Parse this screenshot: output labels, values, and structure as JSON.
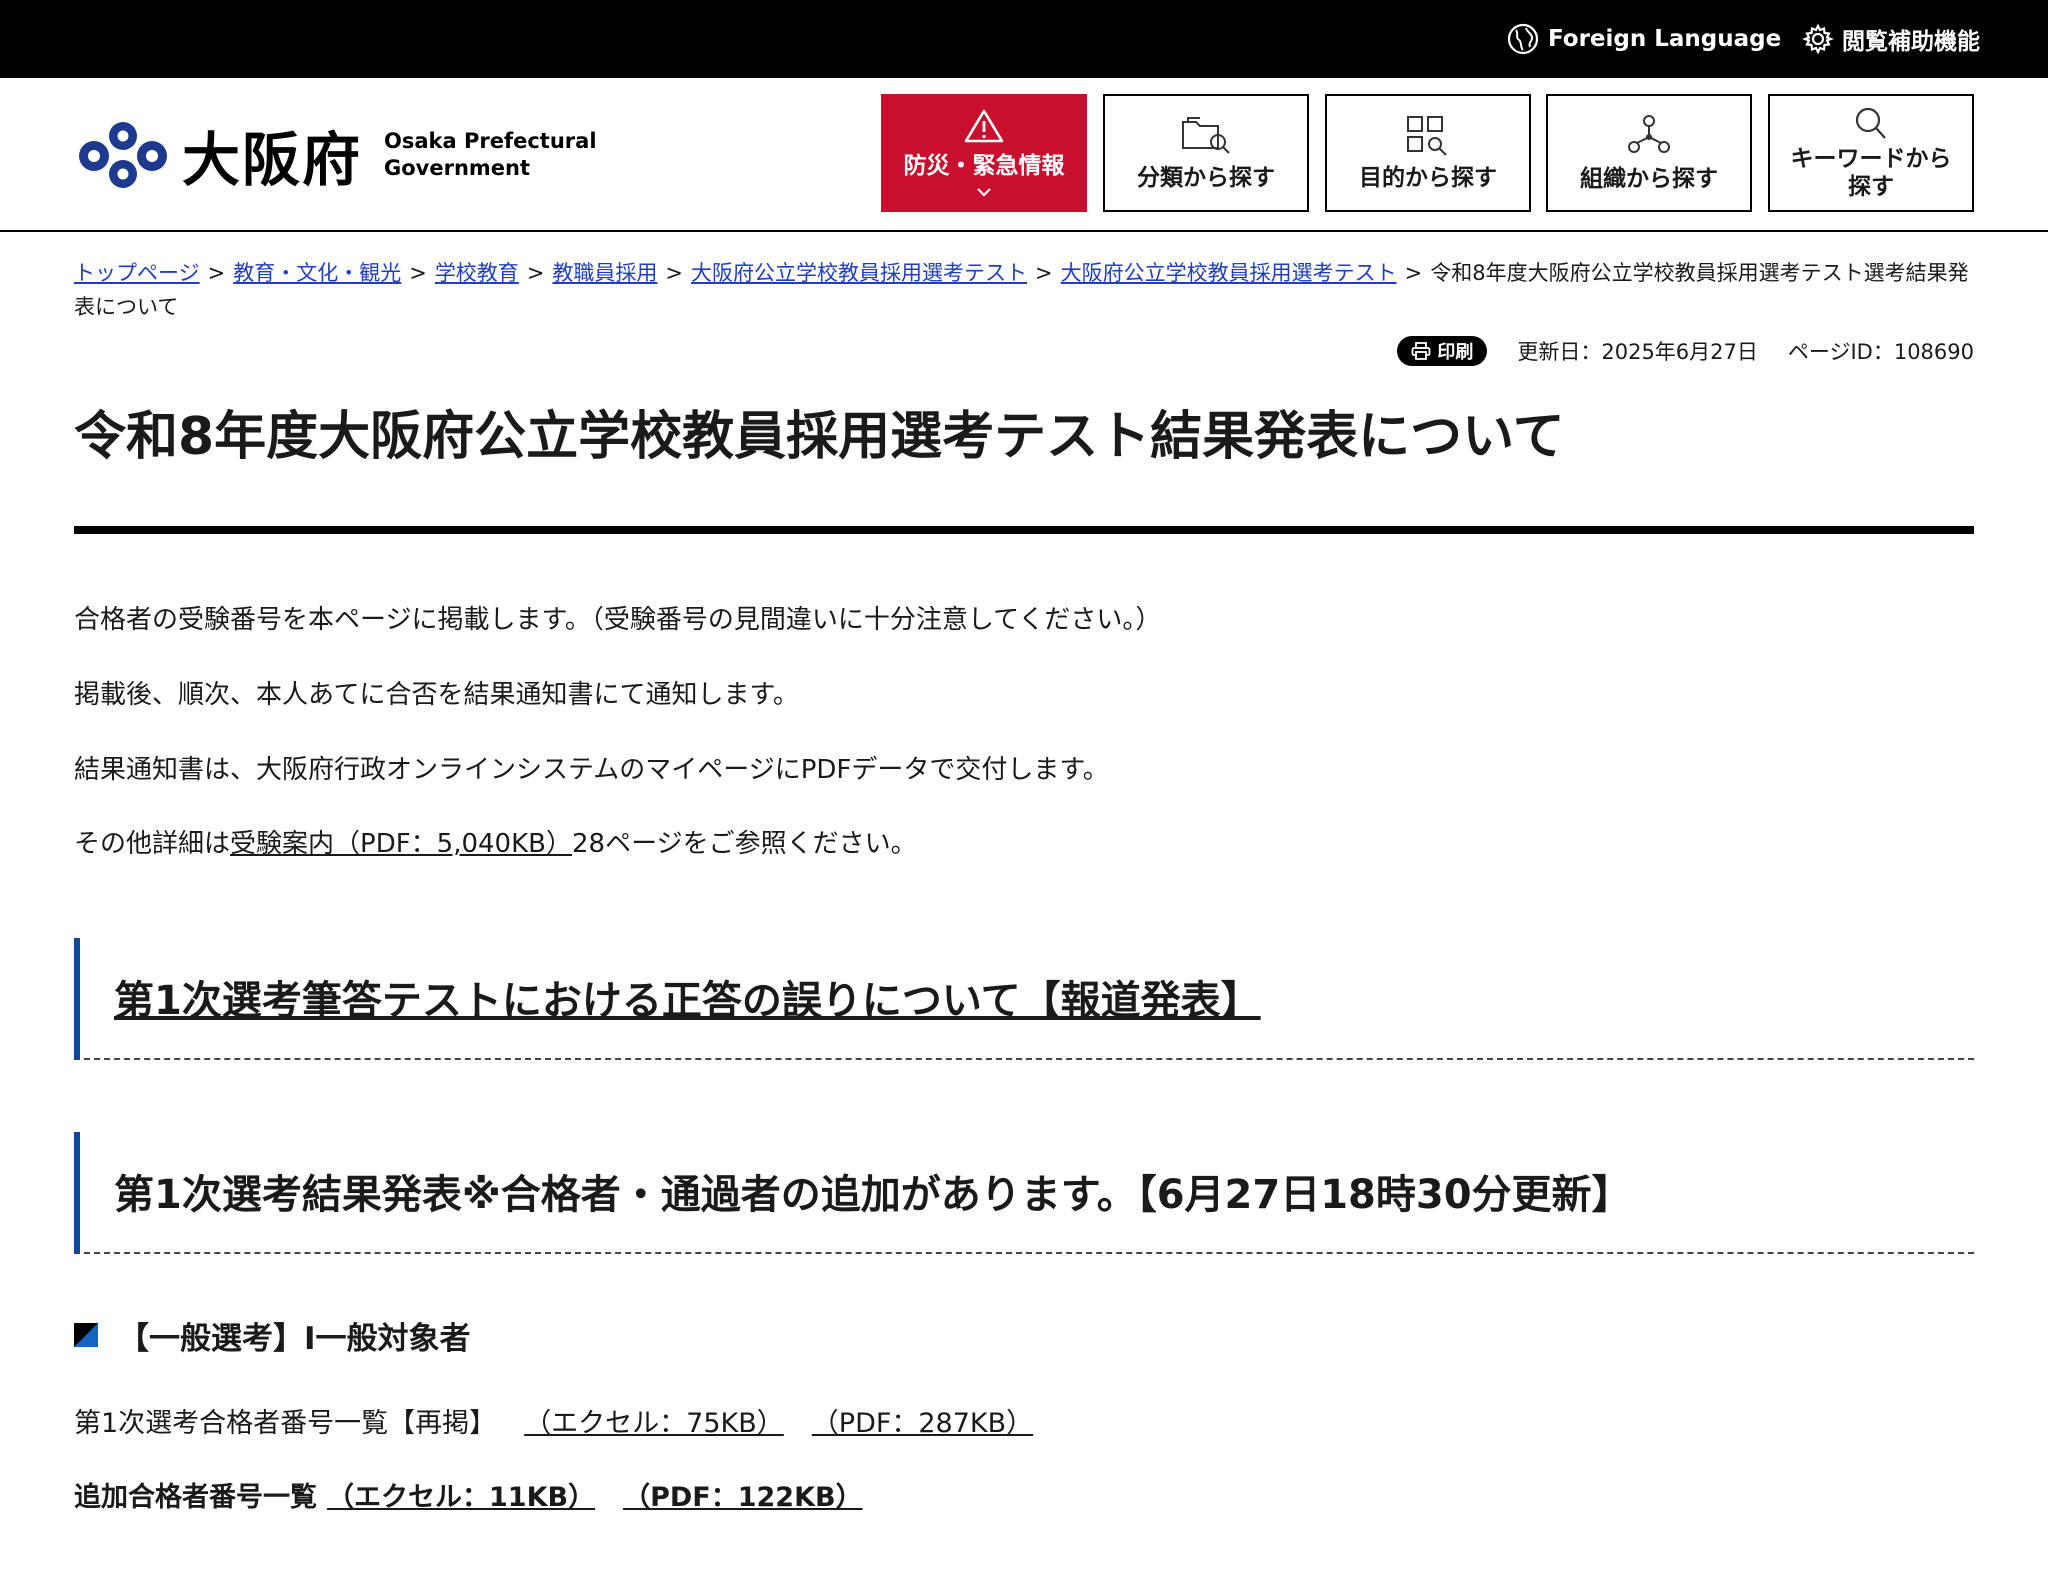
{
  "topbar": {
    "foreign_language": "Foreign Language",
    "accessibility": "閲覧補助機能"
  },
  "logo": {
    "jp": "大阪府",
    "en_line1": "Osaka Prefectural",
    "en_line2": "Government"
  },
  "nav": [
    {
      "label": "防災・緊急情報",
      "icon": "warning-icon"
    },
    {
      "label": "分類から探す",
      "icon": "folder-search-icon"
    },
    {
      "label": "目的から探す",
      "icon": "grid-search-icon"
    },
    {
      "label": "組織から探す",
      "icon": "org-tree-icon"
    },
    {
      "label_line1": "キーワードから",
      "label_line2": "探す",
      "icon": "search-icon"
    }
  ],
  "breadcrumb": {
    "items": [
      "トップページ",
      "教育・文化・観光",
      "学校教育",
      "教職員採用",
      "大阪府公立学校教員採用選考テスト",
      "大阪府公立学校教員採用選考テスト"
    ],
    "separator": ">",
    "current": "令和8年度大阪府公立学校教員採用選考テスト選考結果発表について"
  },
  "meta": {
    "print_label": "印刷",
    "updated": "更新日：2025年6月27日",
    "page_id": "ページID：108690"
  },
  "page_title": "令和8年度大阪府公立学校教員採用選考テスト結果発表について",
  "paragraphs": {
    "p1": "合格者の受験番号を本ページに掲載します。（受験番号の見間違いに十分注意してください。）",
    "p2": "掲載後、順次、本人あてに合否を結果通知書にて通知します。",
    "p3": "結果通知書は、大阪府行政オンラインシステムのマイページにPDFデータで交付します。",
    "p4_before": "その他詳細は",
    "p4_link": "受験案内（PDF：5,040KB）",
    "p4_after": "28ページをご参照ください。"
  },
  "sections": {
    "sec1": "第1次選考筆答テストにおける正答の誤りについて【報道発表】",
    "sec2": "第1次選考結果発表※合格者・通過者の追加があります。【6月27日18時30分更新】"
  },
  "subhead": "【一般選考】Ⅰ一般対象者",
  "downloads": {
    "row1_label": "第1次選考合格者番号一覧【再掲】",
    "row1_excel": "（エクセル：75KB）",
    "row1_pdf": "（PDF：287KB）",
    "row2_label": "追加合格者番号一覧",
    "row2_excel": "（エクセル：11KB）",
    "row2_pdf": "（PDF：122KB）"
  },
  "colors": {
    "emergency_red": "#c8102e",
    "accent_blue": "#0d47a1",
    "link_blue": "#1f3fbf"
  }
}
